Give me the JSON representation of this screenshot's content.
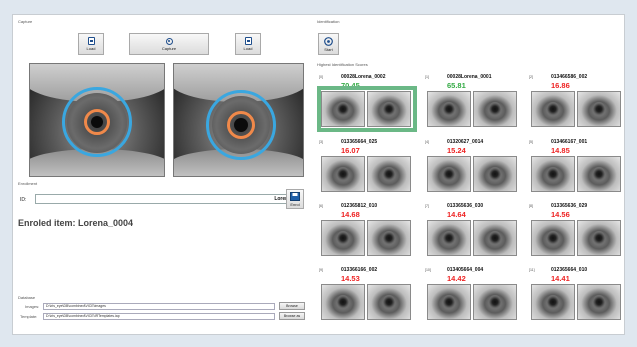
{
  "capture": {
    "section_label": "Capture",
    "load_left_label": "Load",
    "capture_label": "Capture",
    "load_right_label": "Load"
  },
  "enroll": {
    "section_label": "Enrollment",
    "id_label": "ID:",
    "id_value": "Lorena",
    "enroll_button_label": "Enrol",
    "enrolled_message": "Enroled item: Lorena_0004"
  },
  "database": {
    "section_label": "Database",
    "images_label": "Images:",
    "images_path": "D:\\iris_eye\\DB\\combined\\VICE\\images",
    "template_label": "Template:",
    "template_path": "D:\\iris_eye\\DB\\combined\\VICE\\IRTemplates.iap",
    "browse_images_label": "Browse",
    "browse_template_label": "Browse as"
  },
  "identification": {
    "section_label": "Identification",
    "start_label": "Start",
    "scores_label": "Highest Identification Scores"
  },
  "results": [
    {
      "idx": "[0]",
      "name": "00028Lorena_0002",
      "score": "70.45",
      "color": "#33aa44"
    },
    {
      "idx": "[1]",
      "name": "00028Lorena_0001",
      "score": "65.81",
      "color": "#33aa44"
    },
    {
      "idx": "[2]",
      "name": "013466586_002",
      "score": "16.86",
      "color": "#ee2222"
    },
    {
      "idx": "[3]",
      "name": "013365664_025",
      "score": "16.07",
      "color": "#ee2222"
    },
    {
      "idx": "[4]",
      "name": "01320627_0014",
      "score": "15.24",
      "color": "#ee2222"
    },
    {
      "idx": "[5]",
      "name": "013466167_001",
      "score": "14.85",
      "color": "#ee2222"
    },
    {
      "idx": "[6]",
      "name": "012365812_010",
      "score": "14.68",
      "color": "#ee2222"
    },
    {
      "idx": "[7]",
      "name": "013365636_030",
      "score": "14.64",
      "color": "#ee2222"
    },
    {
      "idx": "[8]",
      "name": "013365636_029",
      "score": "14.56",
      "color": "#ee2222"
    },
    {
      "idx": "[9]",
      "name": "013366166_002",
      "score": "14.53",
      "color": "#ee2222"
    },
    {
      "idx": "[10]",
      "name": "013405664_004",
      "score": "14.42",
      "color": "#ee2222"
    },
    {
      "idx": "[11]",
      "name": "012365664_010",
      "score": "14.41",
      "color": "#ee2222"
    }
  ]
}
